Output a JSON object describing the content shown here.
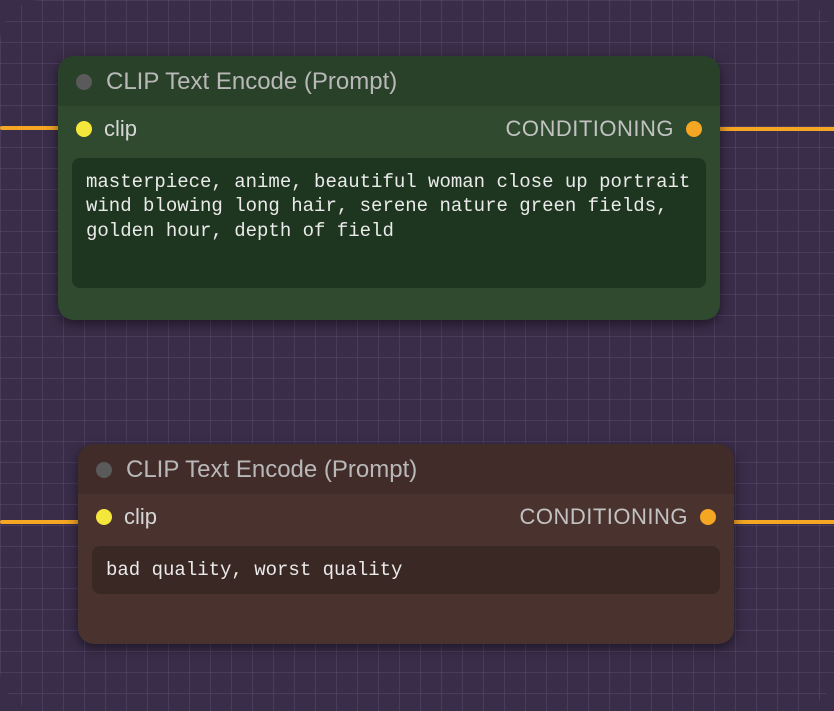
{
  "nodes": {
    "positive": {
      "title": "CLIP Text Encode (Prompt)",
      "input_label": "clip",
      "output_label": "CONDITIONING",
      "text": "masterpiece, anime, beautiful woman close up portrait wind blowing long hair, serene nature green fields, golden hour, depth of field"
    },
    "negative": {
      "title": "CLIP Text Encode (Prompt)",
      "input_label": "clip",
      "output_label": "CONDITIONING",
      "text": "bad quality, worst quality"
    }
  },
  "colors": {
    "wire": "#f5a623",
    "input_port": "#f5e63c",
    "output_port": "#f5a623",
    "node_positive_bg": "#2f4a2f",
    "node_negative_bg": "#4a332f"
  }
}
